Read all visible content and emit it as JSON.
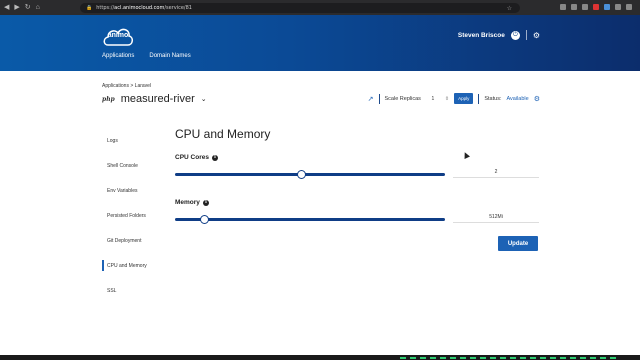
{
  "browser": {
    "url_prefix": "https://",
    "url_domain": "acl.animocloud.com",
    "url_path": "/service/81"
  },
  "header": {
    "logo_text": "anımo",
    "nav": [
      "Applications",
      "Domain Names"
    ],
    "user_name": "Steven Briscoe"
  },
  "breadcrumb": "Applications > Laravel",
  "app": {
    "runtime_badge": "php",
    "title": "measured-river"
  },
  "toolbar": {
    "scale_label": "Scale Replicas",
    "replicas_value": "1",
    "apply_label": "Apply",
    "status_label": "Status:",
    "status_value": "Available"
  },
  "sidebar": {
    "items": [
      {
        "label": "Logs"
      },
      {
        "label": "Shell Console"
      },
      {
        "label": "Env Variables"
      },
      {
        "label": "Persisted Folders"
      },
      {
        "label": "Git Deployment"
      },
      {
        "label": "CPU and Memory",
        "active": true
      },
      {
        "label": "SSL"
      }
    ]
  },
  "panel": {
    "title": "CPU and Memory",
    "cpu": {
      "label": "CPU Cores",
      "value": "2",
      "slider_fraction": 0.47
    },
    "memory": {
      "label": "Memory",
      "value": "512Mi",
      "slider_fraction": 0.11
    },
    "update_label": "Update"
  },
  "colors": {
    "accent": "#1d62b5",
    "header_start": "#0a5aa8",
    "header_end": "#0c2d6c",
    "slider": "#0f3d86"
  }
}
